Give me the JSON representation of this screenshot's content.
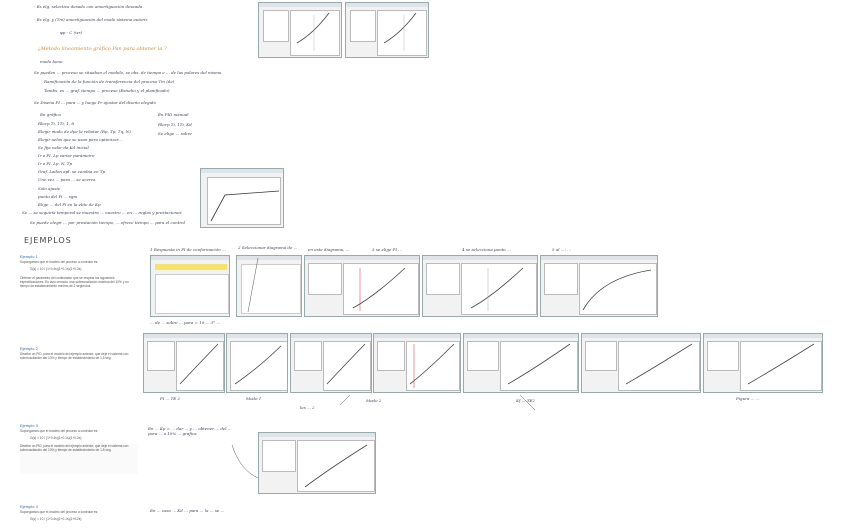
{
  "notes": {
    "line1": "- Es elg. selectiva desado con amortiguación deseada",
    "line2": "- Es elg. y (Tm) amortiguación del modo sistema autoriz",
    "formula1": "φp - C (wr)",
    "proc_title": "¿Método lineamiento gráfico Pan para obtener la ?",
    "proc_sub": "modo bono",
    "step1": "Se pueden ... proceso se situaban el modelo, se obs. de tiempo e ... de las polares del mismo",
    "step1b": "Ramificación de la función de transferencia del proceso Tm (de)",
    "step1c": "Tambs. es ... graf. tiempo ... proceso (Estudio y el planificado)",
    "step2": "Se Diseña PI ... para ... y luego Pr ajustar del diseño elegido",
    "left_col_title": "En gráfico",
    "left_items": [
      "Rlocp Ti, 1Ti, 1, ti",
      "Elegir modo de dpe la rebotar (Rp, Tp, Tq, N)",
      "Elegir aelos que se usan para optimizar...",
      "Se fija valor de Kd inicial",
      "Ir a PI. Lp variar parámetro",
      "Ir a PI. Lp. N, Tp",
      "Graf. Ladon apl. se cambia en Tp",
      "Une vez ... para ... se acerca",
      "Solo ajuste",
      "punto del Pi ... sgm",
      "Elige ... del Pi en la elite de Kp"
    ],
    "right_col_title": "En PID manual",
    "right_items": [
      "Rlocp Ti, 1Ti, Kd",
      "Se elige ... sobre"
    ],
    "step3": "Se ... se seguiría temporal se muestra ... nuestro ... en ... reglas y prestaciones",
    "step3b": "Se puede elegir ... por prestación tiempo, ... ofrece tiempo ... para el control",
    "examples_title": "EJEMPLOS",
    "ex1_head": "Ejemplo 1",
    "ex1_text": "Supongamos que el modelo del proceso a controlar es:",
    "ex1_formula": "G(s) = 10 / (1+0.4s)(1+0.1s)(1+0.2s)",
    "ex1_para": "Obtener el parámetro del controlador que se respeta los siguientes especificaciones. En lazo cerrado: una sobreoscilación máxima del 10% y un tiempo de establecimiento mínimo de 2 segundos.",
    "ann1": "1 Respuesta in PI de conformación ...",
    "ann2": "2 Seleccionar diagrama de ...",
    "ann3": "en este diagrama, ...",
    "ann4": "3 se elige PI ...",
    "ann5": "4 se selecciona punto ...",
    "ann6": "5 al ...: ...",
    "ex1_under": "... de ... sobre ... para = 10 ... 3° ... ",
    "ex2_head": "Ejemplo 2",
    "ex2_para": "Diseñar un PID, para el modelo del ejemplo anterior, que deje el sistema con sobreoscilación del 10% y tiempo de establecimiento de 1.5 seg.",
    "ex2_ann": [
      "PI ... TE 2",
      "Modo 1",
      "les ... 2",
      "Modo 2",
      "Kf ... TE2",
      "Figura ... ..."
    ],
    "ex3_head": "Ejemplo 3",
    "ex3_para": "Supongamos que el modelo del proceso a controlar es:",
    "ex3_note": "En ... Kp = ... dar ... y ... obtener ... del ... para ... a 10% ... grafica",
    "ex4_head": "Ejemplo 4",
    "ex4_para": "Supongamos que el modelo del proceso a controlar es:",
    "ex4_note": "En ... caso ... Kd ... para ... la ... se ..."
  }
}
